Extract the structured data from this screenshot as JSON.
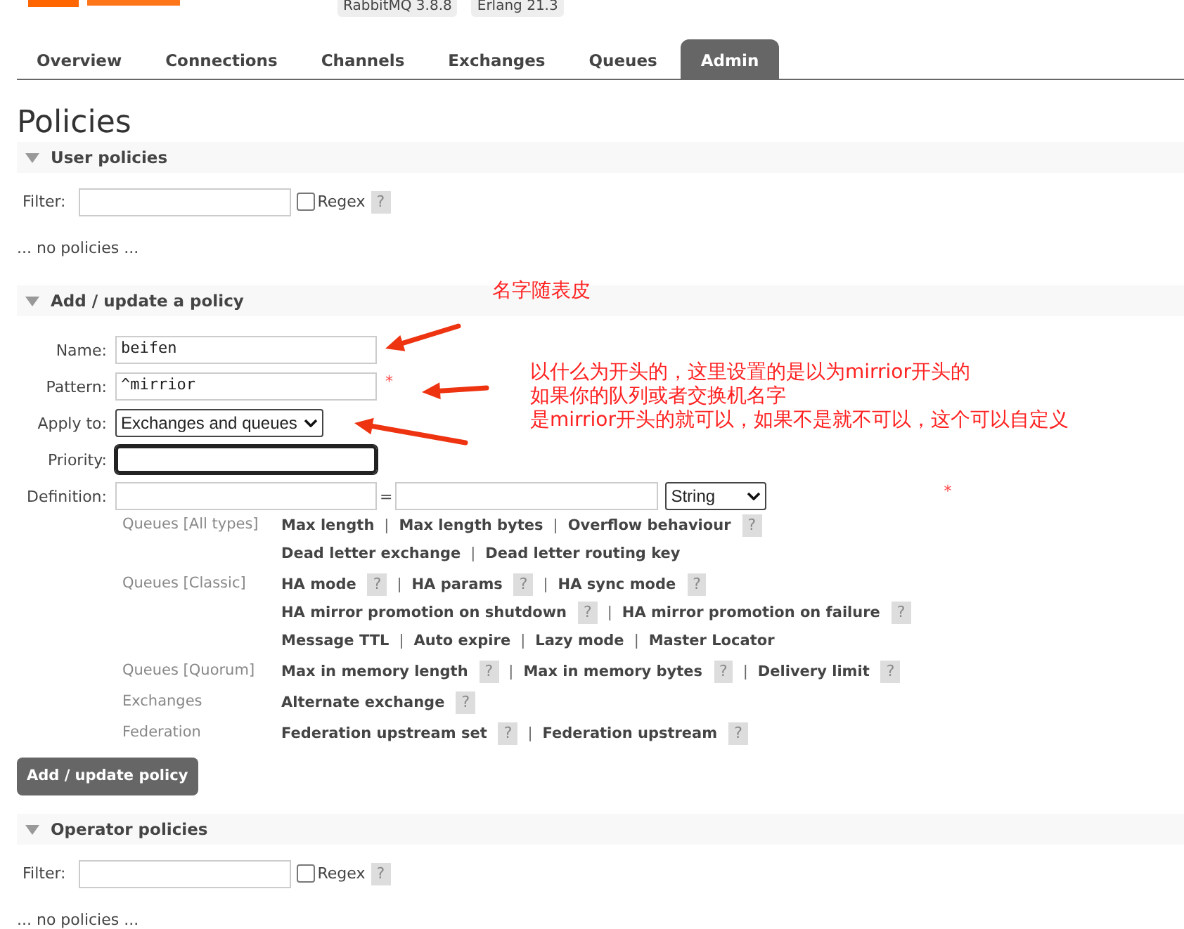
{
  "header": {
    "badges": [
      "RabbitMQ 3.8.8",
      "Erlang 21.3"
    ]
  },
  "tabs": [
    {
      "label": "Overview",
      "selected": false
    },
    {
      "label": "Connections",
      "selected": false
    },
    {
      "label": "Channels",
      "selected": false
    },
    {
      "label": "Exchanges",
      "selected": false
    },
    {
      "label": "Queues",
      "selected": false
    },
    {
      "label": "Admin",
      "selected": true
    }
  ],
  "title": "Policies",
  "user_policies": {
    "heading": "User policies",
    "filter_label": "Filter:",
    "regex_label": "Regex",
    "regex_checked": false,
    "help": "?",
    "empty": "... no policies ..."
  },
  "add_policy": {
    "heading": "Add / update a policy",
    "fields": [
      {
        "kind": "text",
        "label": "Name:",
        "value": "beifen",
        "focused": false
      },
      {
        "kind": "text",
        "label": "Pattern:",
        "value": "^mirrior",
        "required": "*",
        "focused": false
      },
      {
        "kind": "select",
        "label": "Apply to:",
        "value": "Exchanges and queues",
        "focused": false
      },
      {
        "kind": "text",
        "label": "Priority:",
        "focused": true
      }
    ],
    "definition": {
      "label": "Definition:",
      "equals": "=",
      "type": "String",
      "required": "*",
      "separator": "|",
      "groups": [
        {
          "label": "Queues [All types]",
          "lines": [
            [
              {
                "text": "Max length"
              },
              {
                "text": "Max length bytes"
              },
              {
                "text": "Overflow behaviour",
                "help": "?"
              }
            ],
            [
              {
                "text": "Dead letter exchange"
              },
              {
                "text": "Dead letter routing key"
              }
            ]
          ]
        },
        {
          "label": "Queues [Classic]",
          "lines": [
            [
              {
                "text": "HA mode",
                "help": "?"
              },
              {
                "text": "HA params",
                "help": "?"
              },
              {
                "text": "HA sync mode",
                "help": "?"
              }
            ],
            [
              {
                "text": "HA mirror promotion on shutdown",
                "help": "?"
              },
              {
                "text": "HA mirror promotion on failure",
                "help": "?"
              }
            ],
            [
              {
                "text": "Message TTL"
              },
              {
                "text": "Auto expire"
              },
              {
                "text": "Lazy mode"
              },
              {
                "text": "Master Locator"
              }
            ]
          ]
        },
        {
          "label": "Queues [Quorum]",
          "lines": [
            [
              {
                "text": "Max in memory length",
                "help": "?"
              },
              {
                "text": "Max in memory bytes",
                "help": "?"
              },
              {
                "text": "Delivery limit",
                "help": "?"
              }
            ]
          ]
        },
        {
          "label": "Exchanges",
          "lines": [
            [
              {
                "text": "Alternate exchange",
                "help": "?"
              }
            ]
          ]
        },
        {
          "label": "Federation",
          "lines": [
            [
              {
                "text": "Federation upstream set",
                "help": "?"
              },
              {
                "text": "Federation upstream",
                "help": "?"
              }
            ]
          ]
        }
      ]
    },
    "submit": "Add / update policy"
  },
  "operator_policies": {
    "heading": "Operator policies",
    "filter_label": "Filter:",
    "regex_label": "Regex",
    "regex_checked": false,
    "help": "?",
    "empty": "... no policies ..."
  },
  "annotations": [
    {
      "lines": [
        "名字随表皮"
      ]
    },
    {
      "lines": [
        "以什么为开头的，这里设置的是以为mirrior开头的",
        "如果你的队列或者交换机名字",
        "是mirrior开头的就可以，如果不是就不可以，这个可以自定义"
      ]
    }
  ]
}
